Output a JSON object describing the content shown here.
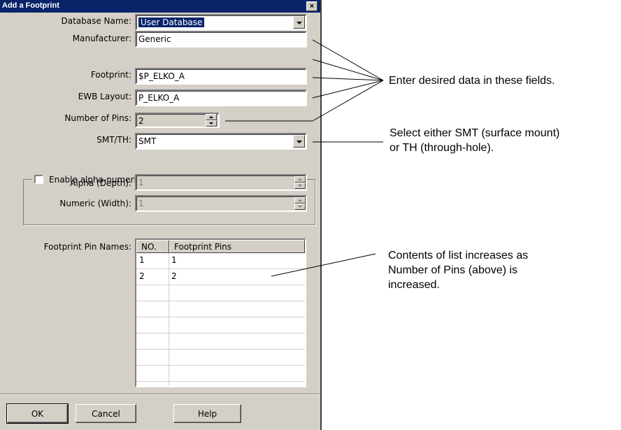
{
  "dialog": {
    "title": "Add a Footprint",
    "close_glyph": "×"
  },
  "fields": {
    "database_name_label": "Database Name:",
    "database_name_value": "User Database",
    "manufacturer_label": "Manufacturer:",
    "manufacturer_value": "Generic",
    "footprint_label": "Footprint:",
    "footprint_value": "$P_ELKO_A",
    "ewb_layout_label": "EWB Layout:",
    "ewb_layout_value": "P_ELKO_A",
    "num_pins_label": "Number of Pins:",
    "num_pins_value": "2",
    "smt_th_label": "SMT/TH:",
    "smt_th_value": "SMT"
  },
  "bga": {
    "label": "Enable alpha-numeric BGA functionality",
    "checked": false,
    "alpha_label": "Alpha (Depth):",
    "alpha_value": "1",
    "numeric_label": "Numeric (Width):",
    "numeric_value": "1"
  },
  "pin_names": {
    "label": "Footprint Pin Names:",
    "columns": [
      "NO.",
      "Footprint Pins"
    ],
    "rows": [
      [
        "1",
        "1"
      ],
      [
        "2",
        "2"
      ]
    ]
  },
  "buttons": {
    "ok": "OK",
    "cancel": "Cancel",
    "help": "Help"
  },
  "annotations": {
    "fields_note": "Enter desired data in these fields.",
    "smt_note_line1": "Select either SMT (surface mount)",
    "smt_note_line2": "or TH (through-hole).",
    "list_note_line1": "Contents of list increases as",
    "list_note_line2": "Number of Pins (above) is",
    "list_note_line3": "increased."
  },
  "colors": {
    "titlebar": "#0a246a",
    "dialog_face": "#d4d0c8",
    "selection": "#0a246a"
  }
}
